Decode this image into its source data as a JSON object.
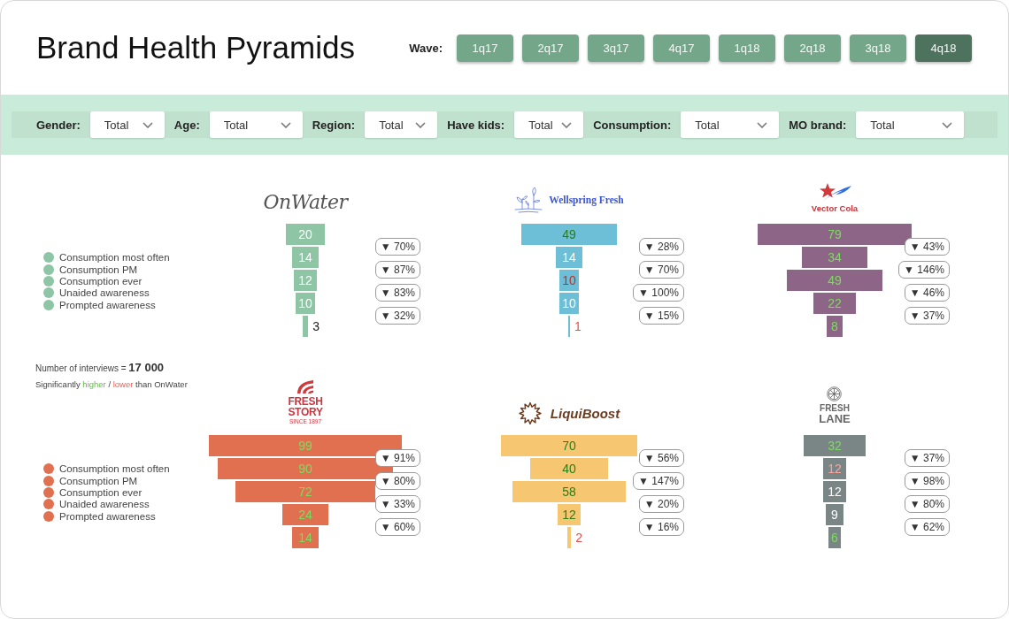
{
  "header": {
    "title": "Brand Health Pyramids",
    "wave_label": "Wave:",
    "waves": [
      {
        "label": "1q17",
        "selected": false
      },
      {
        "label": "2q17",
        "selected": false
      },
      {
        "label": "3q17",
        "selected": false
      },
      {
        "label": "4q17",
        "selected": false
      },
      {
        "label": "1q18",
        "selected": false
      },
      {
        "label": "2q18",
        "selected": false
      },
      {
        "label": "3q18",
        "selected": false
      },
      {
        "label": "4q18",
        "selected": true
      }
    ]
  },
  "filters": [
    {
      "label": "Gender:",
      "value": "Total"
    },
    {
      "label": "Age:",
      "value": "Total"
    },
    {
      "label": "Region:",
      "value": "Total"
    },
    {
      "label": "Have kids:",
      "value": "Total"
    },
    {
      "label": "Consumption:",
      "value": "Total"
    },
    {
      "label": "MO brand:",
      "value": "Total"
    }
  ],
  "rows": [
    {
      "legend": {
        "color": "#8dc5a5",
        "items": [
          "Consumption most often",
          "Consumption PM",
          "Consumption ever",
          "Unaided awareness",
          "Prompted awareness"
        ]
      },
      "panels": [
        {
          "logo": {
            "kind": "script",
            "name_lines": [
              "OnWater"
            ]
          },
          "color": "#8dc5a5",
          "bars": [
            {
              "value": "20",
              "higher": false,
              "lower": false
            },
            {
              "value": "14",
              "higher": false,
              "lower": false
            },
            {
              "value": "12",
              "higher": false,
              "lower": false
            },
            {
              "value": "10",
              "higher": false,
              "lower": false
            },
            {
              "value": "3",
              "higher": false,
              "lower": false
            }
          ],
          "changes": [
            "▼ 70%",
            "▼ 87%",
            "▼ 83%",
            "▼ 32%"
          ]
        },
        {
          "logo": {
            "kind": "serif",
            "name_lines": [
              "Wellspring Fresh"
            ]
          },
          "color": "#6cbfd6",
          "bars": [
            {
              "value": "49",
              "higher": true,
              "lower": false
            },
            {
              "value": "14",
              "higher": false,
              "lower": false
            },
            {
              "value": "10",
              "higher": false,
              "lower": true
            },
            {
              "value": "10",
              "higher": false,
              "lower": false
            },
            {
              "value": "1",
              "higher": false,
              "lower": true
            }
          ],
          "changes": [
            "▼ 28%",
            "▼ 70%",
            "▼ 100%",
            "▼ 15%"
          ]
        },
        {
          "logo": {
            "kind": "emblem",
            "name_lines": [
              "Vector Cola"
            ]
          },
          "color": "#8c6587",
          "bars": [
            {
              "value": "79",
              "higher": true,
              "lower": false
            },
            {
              "value": "34",
              "higher": true,
              "lower": false
            },
            {
              "value": "49",
              "higher": true,
              "lower": false
            },
            {
              "value": "22",
              "higher": true,
              "lower": false
            },
            {
              "value": "8",
              "higher": true,
              "lower": false
            }
          ],
          "changes": [
            "▼ 43%",
            "▼ 146%",
            "▼ 46%",
            "▼ 37%"
          ]
        }
      ]
    },
    {
      "notes": {
        "interviews": "Number of interviews = **17 000**",
        "significance": [
          {
            "text": "Significantly ",
            "higher": false,
            "lower": false
          },
          {
            "text": "higher",
            "higher": true,
            "lower": false
          },
          {
            "text": " / ",
            "higher": false,
            "lower": false
          },
          {
            "text": "lower",
            "higher": false,
            "lower": true
          },
          {
            "text": " than OnWater",
            "higher": false,
            "lower": false
          }
        ]
      },
      "legend": {
        "color": "#e07050",
        "items": [
          "Consumption most often",
          "Consumption PM",
          "Consumption ever",
          "Unaided awareness",
          "Prompted awareness"
        ]
      },
      "panels": [
        {
          "logo": {
            "kind": "stacked",
            "name_lines": [
              "FRESH",
              "STORY"
            ],
            "tagline": "SINCE 1897"
          },
          "color": "#e07050",
          "bars": [
            {
              "value": "99",
              "higher": true,
              "lower": false
            },
            {
              "value": "90",
              "higher": true,
              "lower": false
            },
            {
              "value": "72",
              "higher": true,
              "lower": false
            },
            {
              "value": "24",
              "higher": true,
              "lower": false
            },
            {
              "value": "14",
              "higher": true,
              "lower": false
            }
          ],
          "changes": [
            "▼ 91%",
            "▼ 80%",
            "▼ 33%",
            "▼ 60%"
          ]
        },
        {
          "logo": {
            "kind": "italic",
            "name_lines": [
              "LiquiBoost"
            ]
          },
          "color": "#f6c770",
          "bars": [
            {
              "value": "70",
              "higher": true,
              "lower": false
            },
            {
              "value": "40",
              "higher": true,
              "lower": false
            },
            {
              "value": "58",
              "higher": true,
              "lower": false
            },
            {
              "value": "12",
              "higher": true,
              "lower": false
            },
            {
              "value": "2",
              "higher": false,
              "lower": true
            }
          ],
          "changes": [
            "▼ 56%",
            "▼ 147%",
            "▼ 20%",
            "▼ 16%"
          ]
        },
        {
          "logo": {
            "kind": "block",
            "name_lines": [
              "FRESH",
              "LANE"
            ]
          },
          "color": "#7a8586",
          "bars": [
            {
              "value": "32",
              "higher": true,
              "lower": false
            },
            {
              "value": "12",
              "higher": false,
              "lower": true
            },
            {
              "value": "12",
              "higher": false,
              "lower": false
            },
            {
              "value": "9",
              "higher": false,
              "lower": false
            },
            {
              "value": "6",
              "higher": true,
              "lower": false
            }
          ],
          "changes": [
            "▼ 37%",
            "▼ 98%",
            "▼ 80%",
            "▼ 62%"
          ]
        }
      ]
    }
  ]
}
